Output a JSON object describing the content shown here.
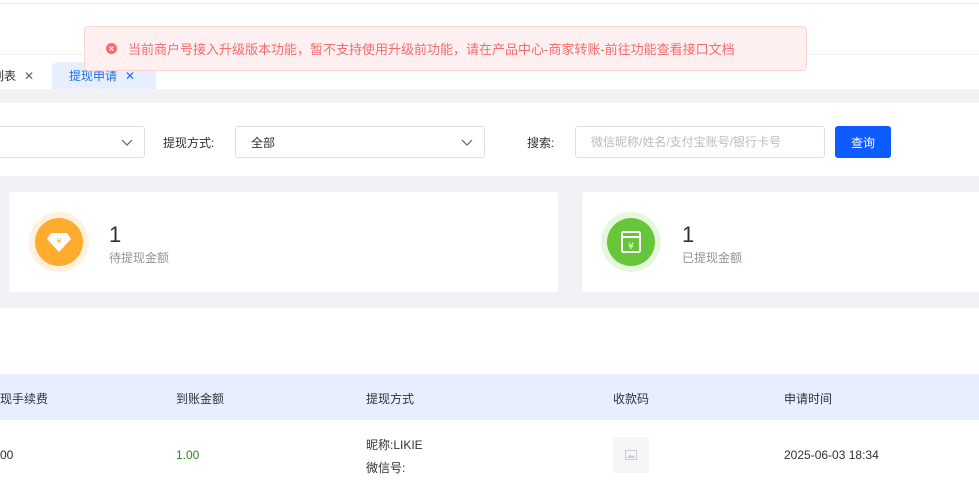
{
  "alert": {
    "message": "当前商户号接入升级版本功能，暂不支持使用升级前功能，请在产品中心-商家转账-前往功能查看接口文档",
    "color": "#f56c6c",
    "icon": "close-circle-icon"
  },
  "tabs": [
    {
      "label": "列表",
      "active": false
    },
    {
      "label": "提现申请",
      "active": true
    }
  ],
  "filters": {
    "method_label": "提现方式:",
    "method_value": "全部",
    "search_label": "搜索:",
    "search_placeholder": "微信昵称/姓名/支付宝账号/银行卡号",
    "query_button": "查询"
  },
  "stats": [
    {
      "value": "1",
      "label": "待提现金额",
      "icon": "diamond-yen-icon",
      "color": "#ffab2e"
    },
    {
      "value": "1",
      "label": "已提现金额",
      "icon": "yen-box-icon",
      "color": "#67c53a"
    }
  ],
  "table": {
    "columns": [
      "现手续费",
      "到账金额",
      "提现方式",
      "收款码",
      "申请时间"
    ],
    "rows": [
      {
        "fee": "00",
        "amount": "1.00",
        "method_nickname": "昵称:LIKIE",
        "method_wechat": "微信号:",
        "qr": "image-placeholder-icon",
        "time": "2025-06-03 18:34"
      }
    ]
  },
  "colors": {
    "primary": "#0e5bff",
    "table_header_bg": "#e7efff",
    "page_bg": "#f0f2f5",
    "amount_green": "#2e8b16"
  }
}
